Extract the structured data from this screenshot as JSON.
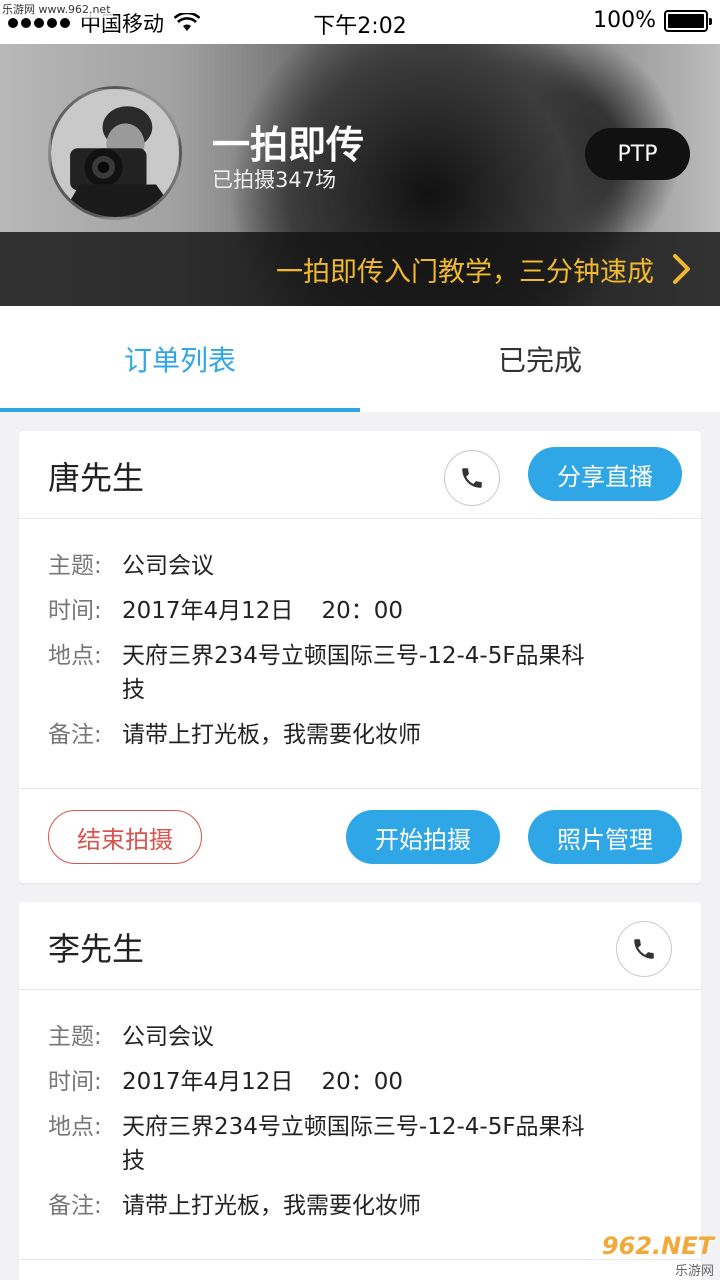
{
  "watermark": {
    "top_left": "乐游网 www.962.net",
    "bottom_right_main": "962.NET",
    "bottom_right_sub": "乐游网"
  },
  "status_bar": {
    "carrier": "中国移动",
    "time": "下午2:02",
    "battery": "100%"
  },
  "header": {
    "title": "一拍即传",
    "subtitle": "已拍摄347场",
    "ptp_label": "PTP",
    "tutorial_text": "一拍即传入门教学，三分钟速成"
  },
  "tabs": [
    {
      "label": "订单列表",
      "active": true
    },
    {
      "label": "已完成",
      "active": false
    }
  ],
  "orders": [
    {
      "name": "唐先生",
      "share_label": "分享直播",
      "subject_label": "主题:",
      "subject": "公司会议",
      "time_label": "时间:",
      "date": "2017年4月12日",
      "time": "20：00",
      "place_label": "地点:",
      "place": "天府三界234号立顿国际三号-12-4-5F品果科技",
      "note_label": "备注:",
      "note": "请带上打光板，我需要化妆师",
      "end_label": "结束拍摄",
      "start_label": "开始拍摄",
      "photos_label": "照片管理"
    },
    {
      "name": "李先生",
      "subject_label": "主题:",
      "subject": "公司会议",
      "time_label": "时间:",
      "date": "2017年4月12日",
      "time": "20：00",
      "place_label": "地点:",
      "place": "天府三界234号立顿国际三号-12-4-5F品果科技",
      "note_label": "备注:",
      "note": "请带上打光板，我需要化妆师"
    }
  ],
  "colors": {
    "accent": "#2fa6e6",
    "danger": "#d9534f",
    "tutorial": "#f0b92e"
  }
}
